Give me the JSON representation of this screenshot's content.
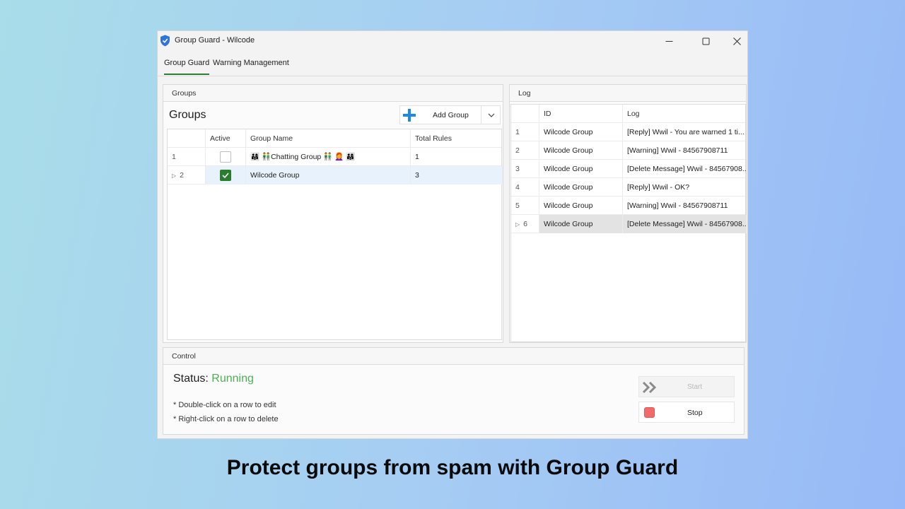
{
  "window": {
    "title": "Group Guard - Wilcode",
    "controls": {
      "minimize": "minimize-icon",
      "maximize": "maximize-icon",
      "close": "close-icon"
    }
  },
  "tabs": [
    {
      "label": "Group Guard",
      "active": true
    },
    {
      "label": "Warning Management",
      "active": false
    }
  ],
  "groups": {
    "panel_title": "Groups",
    "heading": "Groups",
    "add_button": {
      "label": "Add Group",
      "icon": "plus-icon"
    },
    "columns": [
      "Active",
      "Group Name",
      "Total Rules"
    ],
    "rows": [
      {
        "num": "1",
        "active": false,
        "name": "👨‍👩‍👧 👬Chatting Group 👬 👩‍🦰 👨‍👩‍👧",
        "rules": "1"
      },
      {
        "num": "2",
        "active": true,
        "name": "Wilcode Group",
        "rules": "3",
        "selected": true
      }
    ]
  },
  "log": {
    "panel_title": "Log",
    "columns": [
      "ID",
      "Log"
    ],
    "rows": [
      {
        "num": "1",
        "id": "Wilcode Group",
        "log": "[Reply] Wwil - You are warned 1 ti..."
      },
      {
        "num": "2",
        "id": "Wilcode Group",
        "log": "[Warning] Wwil - 84567908711"
      },
      {
        "num": "3",
        "id": "Wilcode Group",
        "log": "[Delete Message] Wwil - 84567908..."
      },
      {
        "num": "4",
        "id": "Wilcode Group",
        "log": "[Reply] Wwil - OK?"
      },
      {
        "num": "5",
        "id": "Wilcode Group",
        "log": "[Warning] Wwil - 84567908711"
      },
      {
        "num": "6",
        "id": "Wilcode Group",
        "log": "[Delete Message] Wwil - 84567908...",
        "selected": true
      }
    ]
  },
  "control": {
    "panel_title": "Control",
    "status_label": "Status:",
    "status_value": "Running",
    "hint_edit": "* Double-click on a row to edit",
    "hint_delete": "* Right-click on a row to delete",
    "start_label": "Start",
    "stop_label": "Stop"
  },
  "caption": "Protect groups from spam with Group Guard",
  "colors": {
    "accent": "#2e7d32",
    "running": "#4caf50",
    "stop": "#f26b6b",
    "plus": "#1e88e5"
  }
}
